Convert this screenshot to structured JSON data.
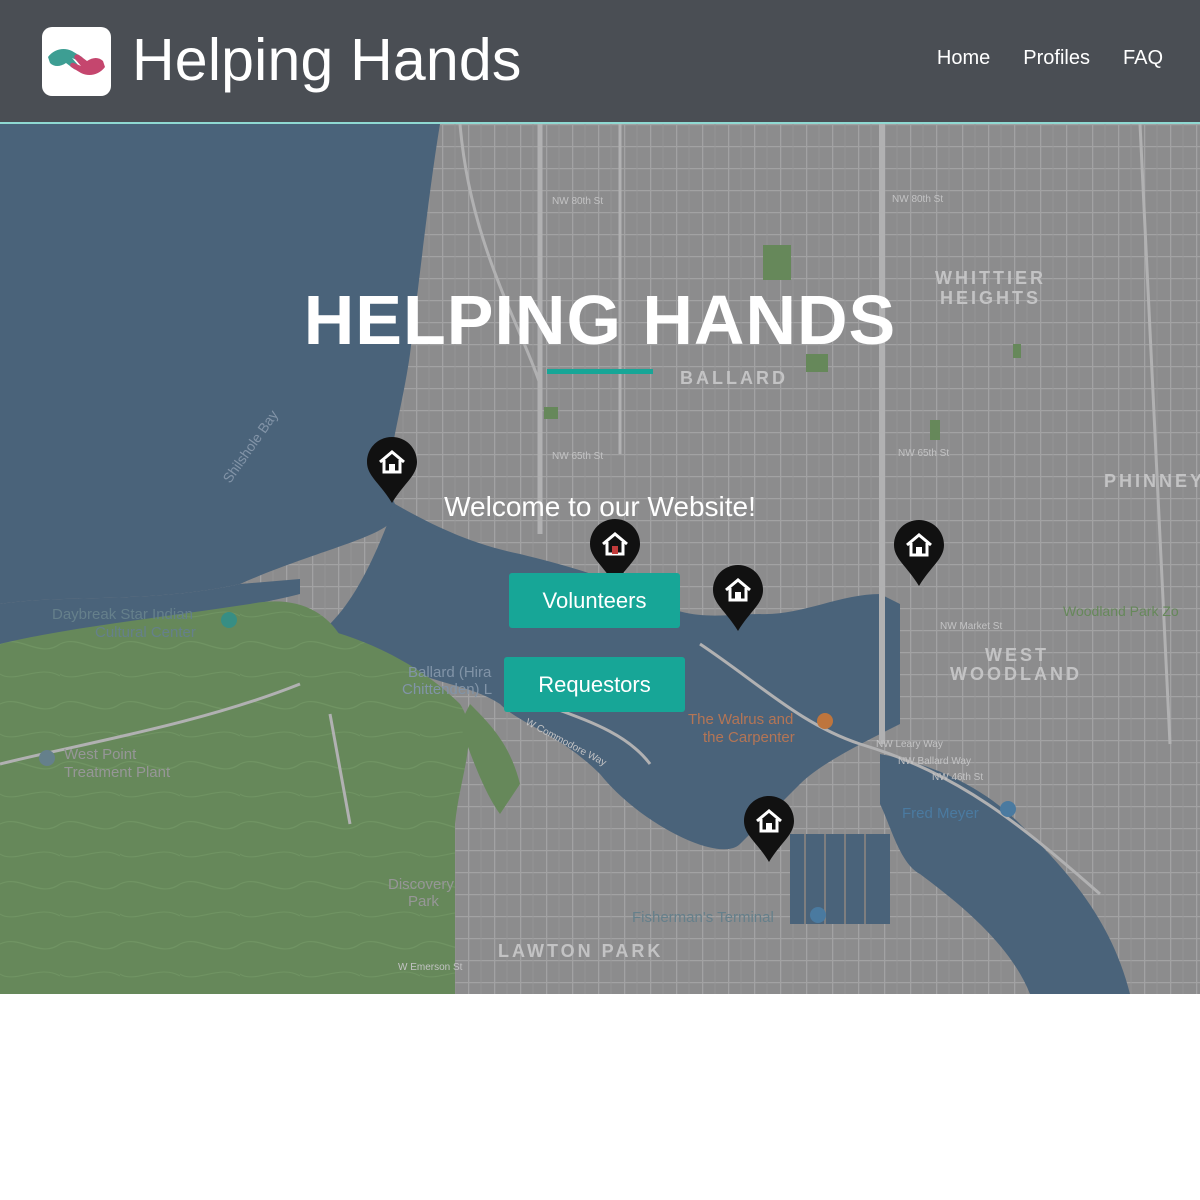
{
  "header": {
    "brand": "Helping Hands",
    "logo_icon": "helping-hands-logo-icon",
    "nav": [
      {
        "label": "Home"
      },
      {
        "label": "Profiles"
      },
      {
        "label": "FAQ"
      }
    ]
  },
  "hero": {
    "title": "HELPING HANDS",
    "welcome": "Welcome to our Website!",
    "buttons": {
      "volunteers": "Volunteers",
      "requestors": "Requestors"
    },
    "pin_icon": "home-pin-icon",
    "map_labels": {
      "nw80": "NW 80th St",
      "nw80b": "NW 80th St",
      "whittier1": "WHITTIER",
      "whittier2": "HEIGHTS",
      "ballard": "BALLARD",
      "phinney": "PHINNEY",
      "nw65": "NW 65th St",
      "nw65b": "NW 65th St",
      "shilshole": "Shilshole Bay",
      "daybreak1": "Daybreak Star Indian",
      "daybreak2": "Cultural Center",
      "ballardlocks1": "Ballard (Hira",
      "ballardlocks2": "Chittenden) L",
      "westpoint1": "West Point",
      "westpoint2": "Treatment Plant",
      "walrus1": "The Walrus and",
      "walrus2": "the Carpenter",
      "westwoodland1": "WEST",
      "westwoodland2": "WOODLAND",
      "woodlandpark": "Woodland Park Zo",
      "nwmarket": "NW Market St",
      "nwleary": "NW Leary Way",
      "nwballard": "NW Ballard Way",
      "nw46": "NW 46th St",
      "fredmeyer": "Fred Meyer",
      "discovery1": "Discovery",
      "discovery2": "Park",
      "fisherman": "Fisherman's Terminal",
      "lawton": "LAWTON PARK",
      "emerson": "W Emerson St",
      "commodore": "W Commodore Way"
    }
  },
  "colors": {
    "navbar": "#4a4e54",
    "accent": "#17a697",
    "water": "#4f6b85",
    "park": "#6f9660",
    "land": "#9b9b9b"
  }
}
